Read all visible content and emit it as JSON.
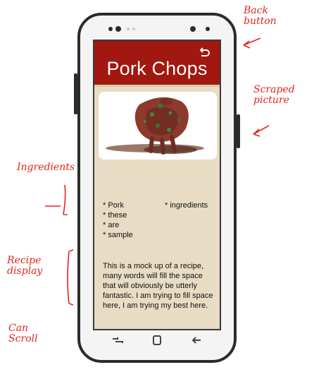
{
  "screen": {
    "title": "Pork Chops",
    "back_icon": "back-arrow-icon",
    "ingredients_left": [
      "* Pork",
      "* these",
      "* are",
      "* sample"
    ],
    "ingredients_right": [
      "* ingredients"
    ],
    "recipe_text": "This is a mock up of a recipe, many words will fill the space that will obviously be utterly fantastic. I am trying to fill space here, I am trying my best here."
  },
  "nav": {
    "icons": [
      "recents-icon",
      "home-icon",
      "back-icon"
    ]
  },
  "annotations": {
    "back_button": "Back button",
    "scraped_picture": "Scraped picture",
    "ingredients": "Ingredients",
    "recipe_display": "Recipe display",
    "can_scroll": "Can Scroll"
  },
  "colors": {
    "header": "#a0180f",
    "screen_bg": "#e8dcc4",
    "annotation": "#e3241b"
  }
}
